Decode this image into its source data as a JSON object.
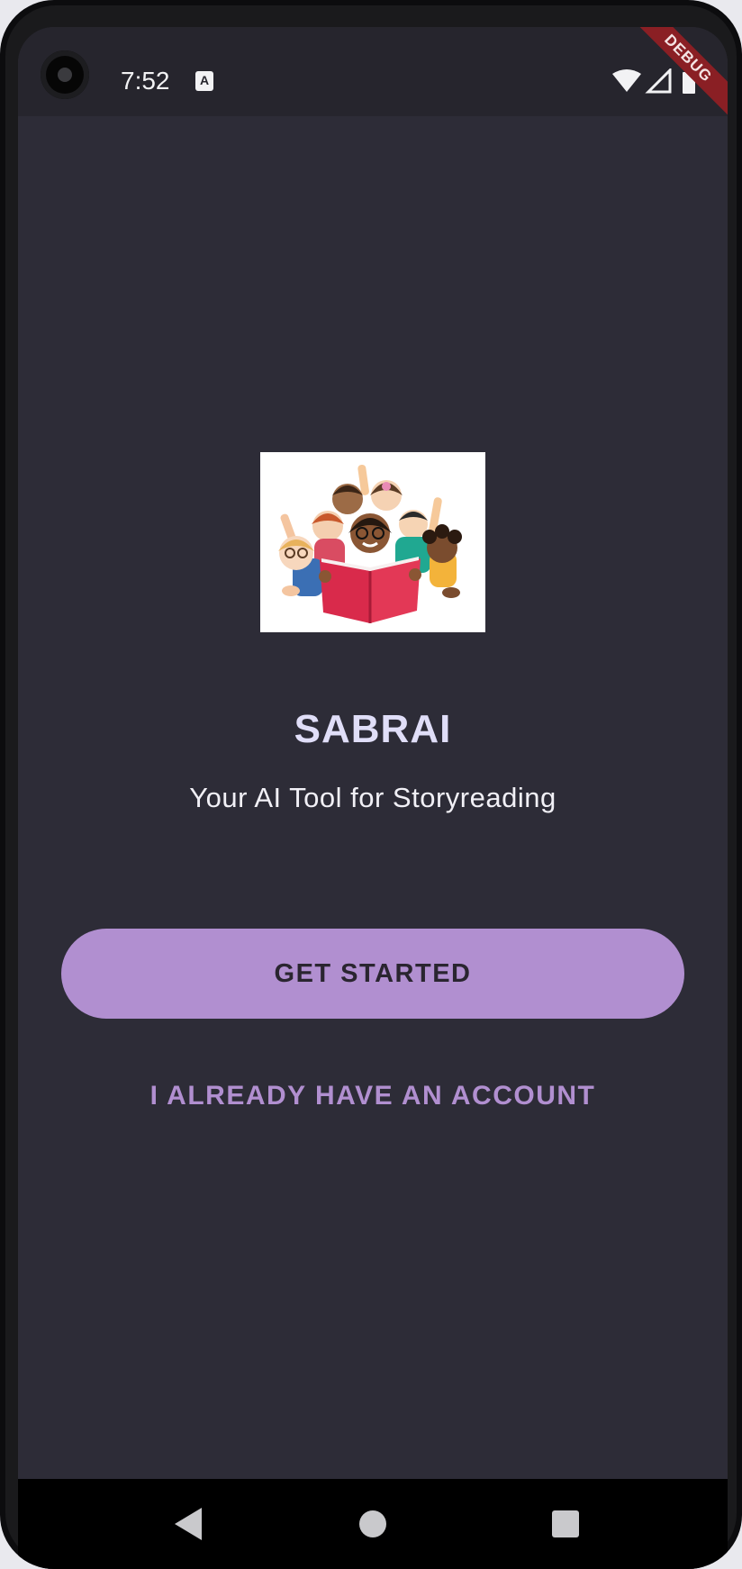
{
  "status_bar": {
    "time": "7:52",
    "notification_icon": "a-notification-icon",
    "icons": [
      "wifi-icon",
      "signal-icon",
      "battery-icon"
    ],
    "debug_banner": "DEBUG"
  },
  "main": {
    "logo_alt": "children reading book illustration",
    "title": "SABRAI",
    "subtitle": "Your AI Tool for Storyreading",
    "primary_button": "GET STARTED",
    "secondary_button": "I ALREADY HAVE AN ACCOUNT"
  },
  "nav_bar": {
    "icons": [
      "back-icon",
      "home-icon",
      "recents-icon"
    ]
  },
  "colors": {
    "background": "#2d2c37",
    "accent": "#b18fd0",
    "title": "#e0def8",
    "text": "#f1f0f6"
  }
}
